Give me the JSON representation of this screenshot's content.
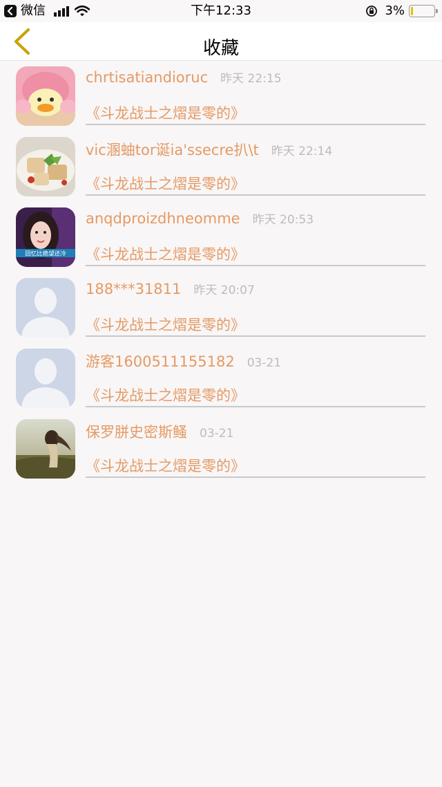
{
  "status_bar": {
    "back_app": "微信",
    "time": "下午12:33",
    "battery_percent": "3%",
    "battery_level": 0.03,
    "icons": [
      "back-badge-icon",
      "signal-icon",
      "wifi-icon",
      "rotation-lock-icon",
      "battery-icon"
    ]
  },
  "nav": {
    "title": "收藏",
    "back_icon": "chevron-left-icon",
    "accent_color": "#c9a200"
  },
  "colors": {
    "accent": "#e59a63",
    "time_gray": "#bcbcbc",
    "divider": "#c9c9c9",
    "background": "#f8f6f7"
  },
  "items": [
    {
      "username": "chrtisatiandioruc",
      "time": "昨天 22:15",
      "title": "《斗龙战士之熠是零的》",
      "avatar": "duck-avatar"
    },
    {
      "username": "vic溷蚰tor诞ia'ssecre扒\\t",
      "time": "昨天 22:14",
      "title": "《斗龙战士之熠是零的》",
      "avatar": "food-avatar"
    },
    {
      "username": "anqdproizdhneomme",
      "time": "昨天 20:53",
      "title": "《斗龙战士之熠是零的》",
      "avatar": "girl-avatar",
      "avatar_caption": "回忆比绝望还冷"
    },
    {
      "username": "188***31811",
      "time": "昨天 20:07",
      "title": "《斗龙战士之熠是零的》",
      "avatar": "default-avatar"
    },
    {
      "username": "游客1600511155182",
      "time": "03-21",
      "title": "《斗龙战士之熠是零的》",
      "avatar": "default-avatar"
    },
    {
      "username": "保罗胼史密斯鳋",
      "time": "03-21",
      "title": "《斗龙战士之熠是零的》",
      "avatar": "landscape-avatar"
    }
  ]
}
